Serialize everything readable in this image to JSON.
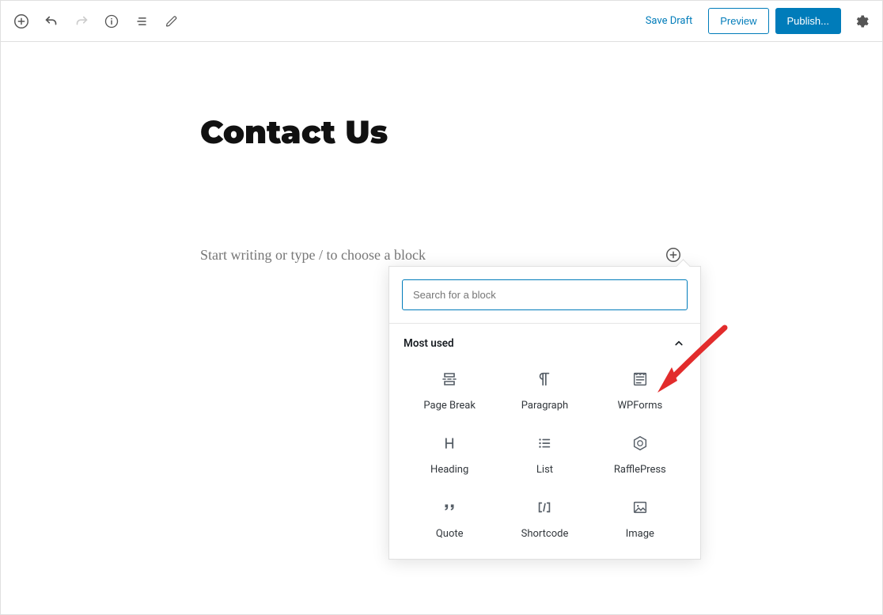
{
  "toolbar": {
    "save_draft": "Save Draft",
    "preview": "Preview",
    "publish": "Publish..."
  },
  "editor": {
    "title": "Contact Us",
    "placeholder": "Start writing or type / to choose a block"
  },
  "block_inserter": {
    "search_placeholder": "Search for a block",
    "section_title": "Most used",
    "blocks": [
      {
        "name": "Page Break"
      },
      {
        "name": "Paragraph"
      },
      {
        "name": "WPForms"
      },
      {
        "name": "Heading"
      },
      {
        "name": "List"
      },
      {
        "name": "RafflePress"
      },
      {
        "name": "Quote"
      },
      {
        "name": "Shortcode"
      },
      {
        "name": "Image"
      }
    ]
  }
}
